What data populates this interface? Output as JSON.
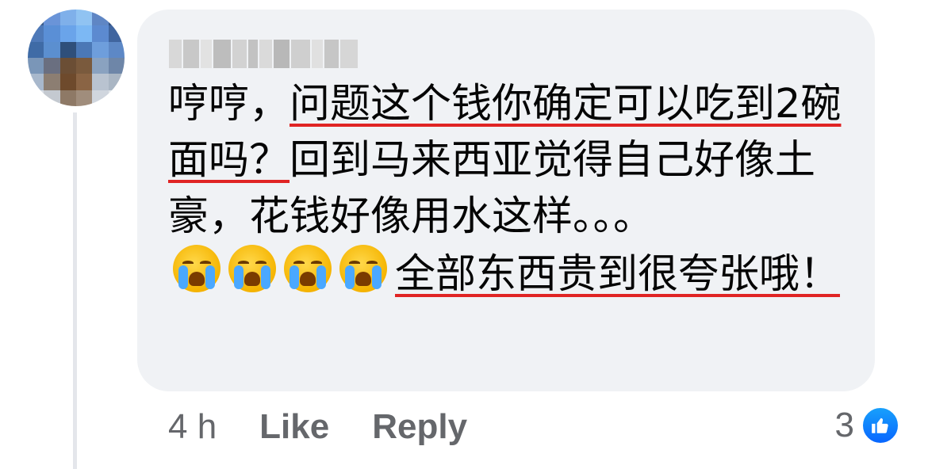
{
  "comment": {
    "avatar": {
      "colors": [
        "#3b5c8a",
        "#6a94d8",
        "#7fb0ea",
        "#90c3f2",
        "#5f86c4",
        "#2e4f80",
        "#4e79b8",
        "#5a8fd6",
        "#6aa4ea",
        "#7cb8f4",
        "#5c8ad0",
        "#40659f",
        "#3f6ba6",
        "#5b8fd0",
        "#2f4f7a",
        "#4b78b6",
        "#6e9edc",
        "#5d88c6",
        "#7a96b8",
        "#6a6f80",
        "#6b4e35",
        "#7a5a3d",
        "#8aa2c0",
        "#6e86a8",
        "#a8b8cc",
        "#8c7e72",
        "#6e4a2c",
        "#8a6444",
        "#b9c3d0",
        "#aab6c4",
        "#d8dde4",
        "#c4c9d0",
        "#8e7966",
        "#a08d7c",
        "#d0d6de",
        "#e2e6ea"
      ]
    },
    "author_redacted_colors": [
      "#d8d8d8",
      "#c8c8c8",
      "#e2e2e2",
      "#bdbdbd",
      "#d2d2d2",
      "#c2c2c2",
      "#dadada",
      "#b8b8b8",
      "#cfcfcf",
      "#e0e0e0",
      "#c6c6c6",
      "#d6d6d6"
    ],
    "text": {
      "part1": "哼哼，",
      "part2": "问题这个钱你确定可以吃到2碗面吗？",
      "part3": "回到马来西亚觉得自己好像土豪，花钱好像用水这样。。。",
      "part4": "全部东西贵到很夸张哦！"
    },
    "emojis": [
      "loudly-crying-face",
      "loudly-crying-face",
      "loudly-crying-face",
      "loudly-crying-face"
    ],
    "underline_color": "#e02424",
    "footer": {
      "time": "4 h",
      "like_label": "Like",
      "reply_label": "Reply"
    },
    "reactions": {
      "count": "3",
      "icon": "thumbs-up-icon",
      "badge_color": "#0866ff"
    }
  }
}
